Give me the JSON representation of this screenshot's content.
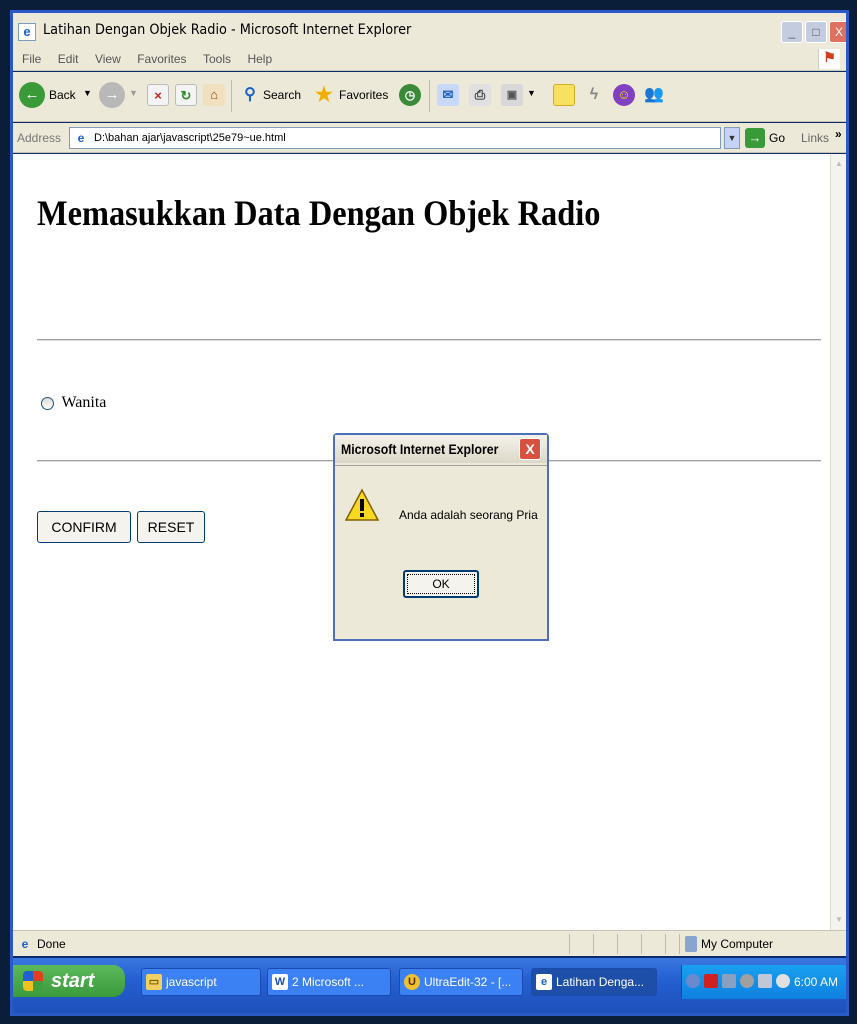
{
  "window": {
    "title": "Latihan Dengan Objek Radio - Microsoft Internet Explorer",
    "min_glyph": "_",
    "max_glyph": "□",
    "close_glyph": "X"
  },
  "menu": {
    "items": [
      "File",
      "Edit",
      "View",
      "Favorites",
      "Tools",
      "Help"
    ]
  },
  "toolbar": {
    "back_label": "Back",
    "search_label": "Search",
    "favorites_label": "Favorites"
  },
  "address": {
    "label": "Address",
    "value": "D:\\bahan ajar\\javascript\\25e79~ue.html",
    "go_label": "Go",
    "links_label": "Links",
    "links_chevron": "»"
  },
  "page": {
    "heading": "Memasukkan Data Dengan Objek Radio",
    "radio_label": "Wanita",
    "confirm_label": "CONFIRM",
    "reset_label": "RESET"
  },
  "dialog": {
    "title": "Microsoft Internet Explorer",
    "close_glyph": "X",
    "message": "Anda adalah seorang Pria",
    "ok_label": "OK"
  },
  "status": {
    "text": "Done",
    "zone": "My Computer"
  },
  "taskbar": {
    "start_label": "start",
    "tasks": [
      {
        "label": "javascript",
        "icon": "folder-icon"
      },
      {
        "label": "2 Microsoft ...",
        "icon": "word-icon"
      },
      {
        "label": "UltraEdit-32 - [...",
        "icon": "ultraedit-icon"
      },
      {
        "label": "Latihan Denga...",
        "icon": "ie-icon"
      }
    ],
    "clock": "6:00 AM"
  },
  "colors": {
    "taskbar_blue": "#245ed0",
    "start_green": "#3a9a3a",
    "close_red": "#e07060"
  }
}
